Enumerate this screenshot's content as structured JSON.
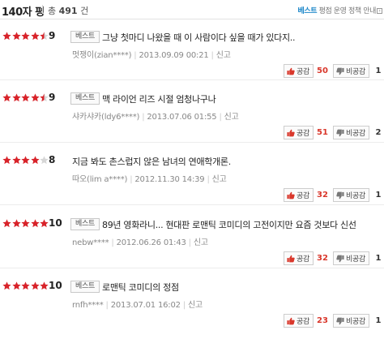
{
  "header": {
    "title": "140자 평",
    "total_prefix": "총",
    "total_count": "491",
    "total_suffix": "건",
    "best_label": "베스트",
    "policy_label": "평점 운영 정책 안내"
  },
  "labels": {
    "like": "공감",
    "dislike": "비공감",
    "report": "신고",
    "best_badge": "베스트"
  },
  "colors": {
    "star": "#d8232a",
    "star_empty": "#d6d6d6",
    "like_count": "#d9372b",
    "best_accent": "#1e88c9"
  },
  "reviews": [
    {
      "stars": 4.5,
      "score": "9",
      "badge": "베스트",
      "text": "그냥 첫마디 나왔을 때 이 사람이다 싶을 때가 있다지..",
      "user": "멋쟁이(zian****)",
      "date": "2013.09.09 00:21",
      "report": "신고",
      "likes": "50",
      "dislikes": "1"
    },
    {
      "stars": 4.5,
      "score": "9",
      "badge": "베스트",
      "text": "맥 라이언 리즈 시절 엄청나구나",
      "user": "샤카샤카(ldy6****)",
      "date": "2013.07.06 01:55",
      "report": "신고",
      "likes": "51",
      "dislikes": "2"
    },
    {
      "stars": 4,
      "score": "8",
      "badge": "",
      "text": "지금 봐도 촌스럽지 않은 남녀의 연애학개론.",
      "user": "따오(lim a****)",
      "date": "2012.11.30 14:39",
      "report": "신고",
      "likes": "32",
      "dislikes": "1"
    },
    {
      "stars": 5,
      "score": "10",
      "badge": "베스트",
      "text": "89년 영화라니... 현대판 로맨틱 코미디의 고전이지만 요즘 것보다 신선",
      "user": "nebw****",
      "date": "2012.06.26 01:43",
      "report": "신고",
      "likes": "32",
      "dislikes": "1"
    },
    {
      "stars": 5,
      "score": "10",
      "badge": "베스트",
      "text": "로맨틱 코미디의 정점",
      "user": "rnfh****",
      "date": "2013.07.01 16:02",
      "report": "신고",
      "likes": "23",
      "dislikes": "1"
    }
  ]
}
